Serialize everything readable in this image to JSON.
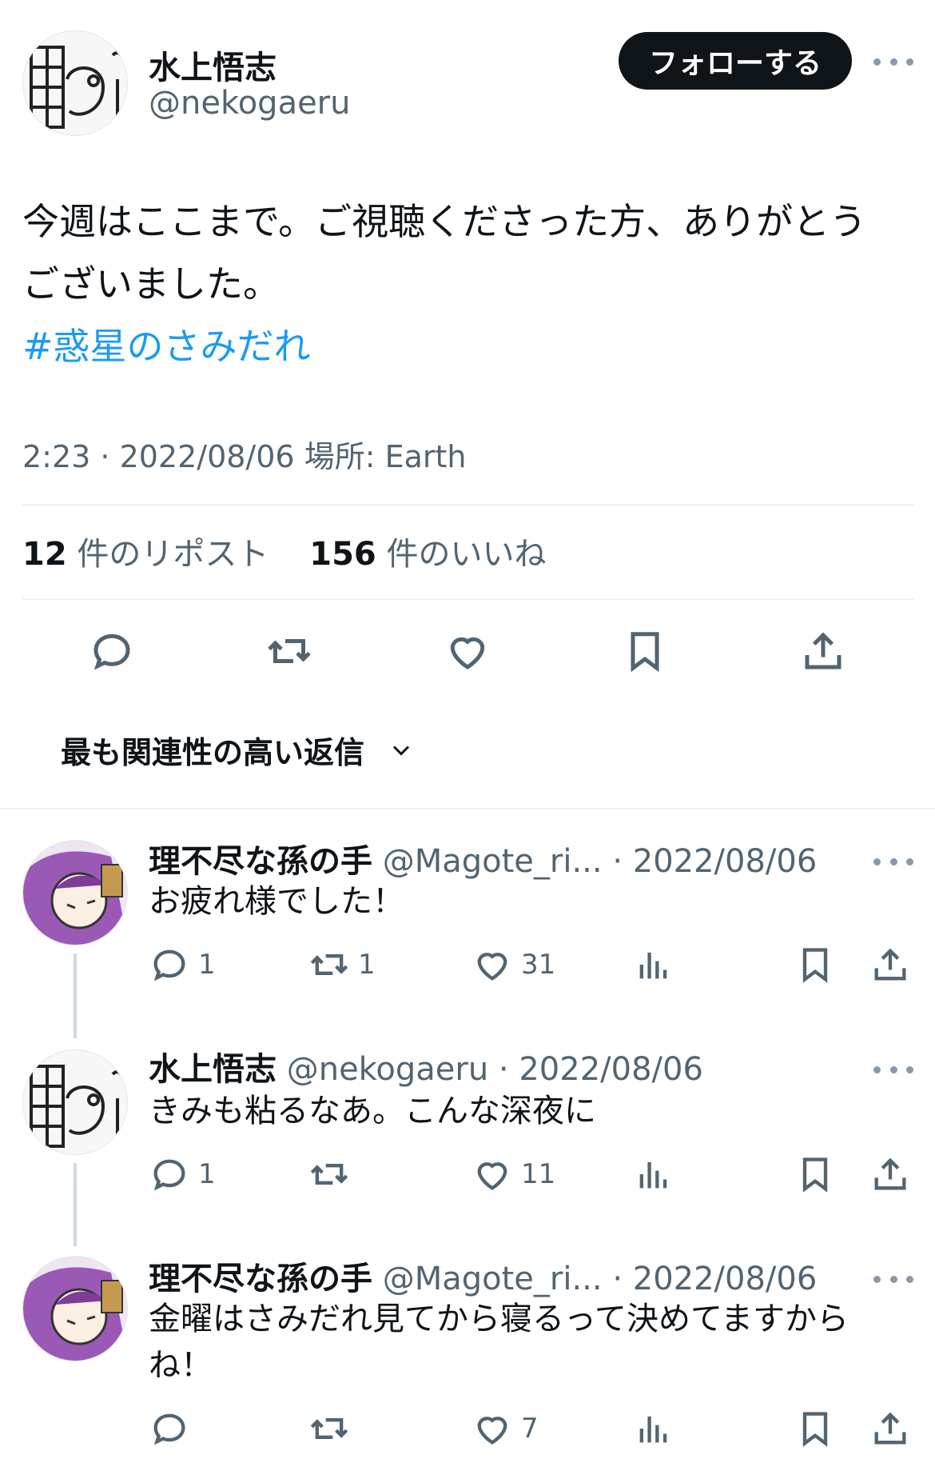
{
  "tweet": {
    "author_name": "水上悟志",
    "author_handle": "@nekogaeru",
    "follow_label": "フォローする",
    "text_line1": "今週はここまで。ご視聴くださった方、ありがとう",
    "text_line2": "ございました。",
    "hashtag": "#惑星のさみだれ",
    "time": "2:23 · 2022/08/06",
    "location_label": "場所: Earth",
    "reposts_count": "12",
    "reposts_label": "件のリポスト",
    "likes_count": "156",
    "likes_label": "件のいいね"
  },
  "sort": {
    "label": "最も関連性の高い返信"
  },
  "replies": [
    {
      "name": "理不尽な孫の手",
      "handle": "@Magote_ri...",
      "date": "· 2022/08/06",
      "text": "お疲れ様でした！",
      "reply_count": "1",
      "repost_count": "1",
      "like_count": "31"
    },
    {
      "name": "水上悟志",
      "handle": "@nekogaeru",
      "date": "· 2022/08/06",
      "text": "きみも粘るなあ。こんな深夜に",
      "reply_count": "1",
      "repost_count": "",
      "like_count": "11"
    },
    {
      "name": "理不尽な孫の手",
      "handle": "@Magote_ri...",
      "date": "· 2022/08/06",
      "text_line1": "金曜はさみだれ見てから寝るって決めてますから",
      "text_line2": "ね！",
      "reply_count": "",
      "repost_count": "",
      "like_count": "7"
    }
  ],
  "colors": {
    "text": "#0f1419",
    "secondary": "#536471",
    "link": "#1d9bf0",
    "divider": "#eff3f4",
    "avatar_purple": "#9b59b6"
  },
  "icons": [
    "reply-icon",
    "repost-icon",
    "like-icon",
    "bookmark-icon",
    "share-icon",
    "views-icon",
    "more-icon",
    "chevron-down-icon"
  ]
}
